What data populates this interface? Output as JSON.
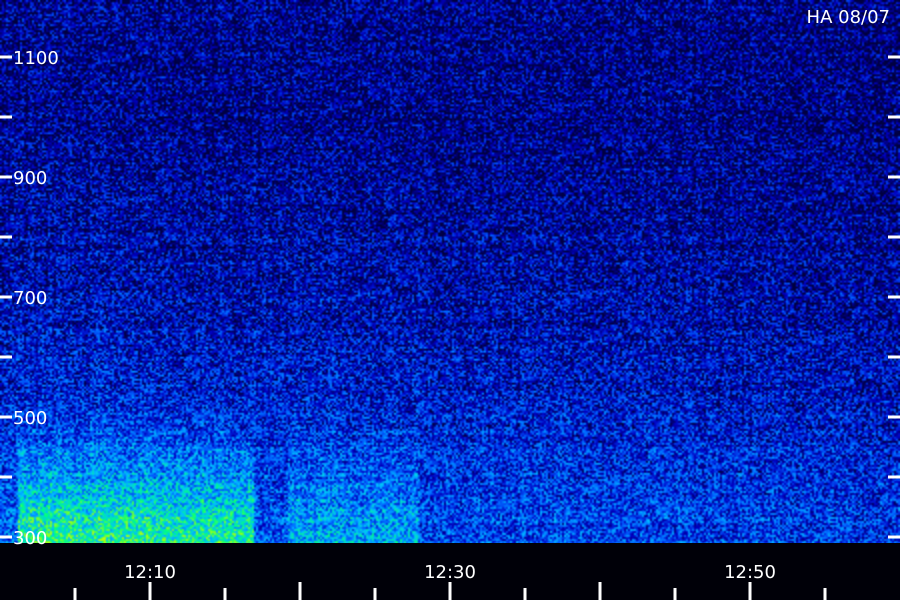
{
  "chart_data": {
    "type": "heatmap",
    "title": "HA 08/07",
    "y_ticks": [
      {
        "value": 1100,
        "label": "1100"
      },
      {
        "value": 1000,
        "label": ""
      },
      {
        "value": 900,
        "label": "900"
      },
      {
        "value": 800,
        "label": ""
      },
      {
        "value": 700,
        "label": "700"
      },
      {
        "value": 600,
        "label": ""
      },
      {
        "value": 500,
        "label": "500"
      },
      {
        "value": 400,
        "label": ""
      },
      {
        "value": 300,
        "label": "300"
      }
    ],
    "x_ticks": [
      {
        "value": "12:10",
        "label": "12:10"
      },
      {
        "value": "12:30",
        "label": "12:30"
      },
      {
        "value": "12:50",
        "label": "12:50"
      }
    ],
    "ylim": [
      280,
      1160
    ],
    "xlim": [
      "12:01",
      "12:59"
    ],
    "colormap": [
      "#000040",
      "#0000c0",
      "#0060ff",
      "#00c0ff",
      "#00ff80",
      "#c0ff00"
    ],
    "intensity_peak_regions": [
      {
        "time": "12:02-12:16",
        "freq": "300-500",
        "level": "high"
      },
      {
        "time": "12:20-12:27",
        "freq": "300-480",
        "level": "medium"
      }
    ]
  }
}
